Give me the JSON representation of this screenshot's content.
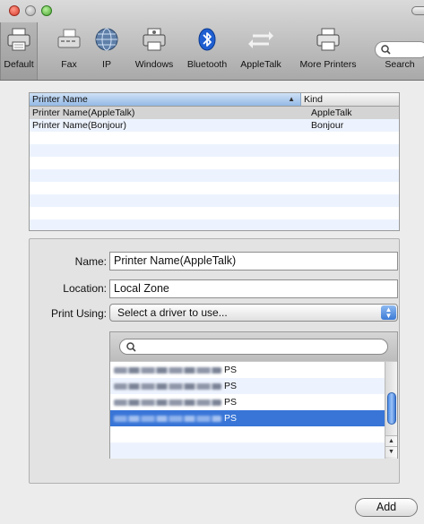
{
  "toolbar": {
    "items": [
      {
        "label": "Default",
        "icon": "printer-icon"
      },
      {
        "label": "Fax",
        "icon": "fax-icon"
      },
      {
        "label": "IP",
        "icon": "globe-icon"
      },
      {
        "label": "Windows",
        "icon": "windows-printer-icon"
      },
      {
        "label": "Bluetooth",
        "icon": "bluetooth-icon"
      },
      {
        "label": "AppleTalk",
        "icon": "appletalk-arrows-icon"
      },
      {
        "label": "More Printers",
        "icon": "more-printers-icon"
      },
      {
        "label": "Search",
        "icon": "search-icon"
      }
    ]
  },
  "printer_list": {
    "columns": [
      "Printer Name",
      "Kind"
    ],
    "sort_indicator": "▲",
    "rows": [
      {
        "name": "Printer Name(AppleTalk)",
        "kind": "AppleTalk",
        "selected": true
      },
      {
        "name": "Printer Name(Bonjour)",
        "kind": "Bonjour",
        "selected": false
      }
    ]
  },
  "details": {
    "name_label": "Name:",
    "name_value": "Printer Name(AppleTalk)",
    "location_label": "Location:",
    "location_value": "Local Zone",
    "print_using_label": "Print Using:",
    "print_using_value": "Select a driver to use...",
    "drivers": [
      {
        "suffix": "PS",
        "selected": false
      },
      {
        "suffix": "PS",
        "selected": false
      },
      {
        "suffix": "PS",
        "selected": false
      },
      {
        "suffix": "PS",
        "selected": true
      }
    ]
  },
  "add_label": "Add",
  "colors": {
    "selection": "#3875d7",
    "header_accent": "#94b9e6"
  }
}
